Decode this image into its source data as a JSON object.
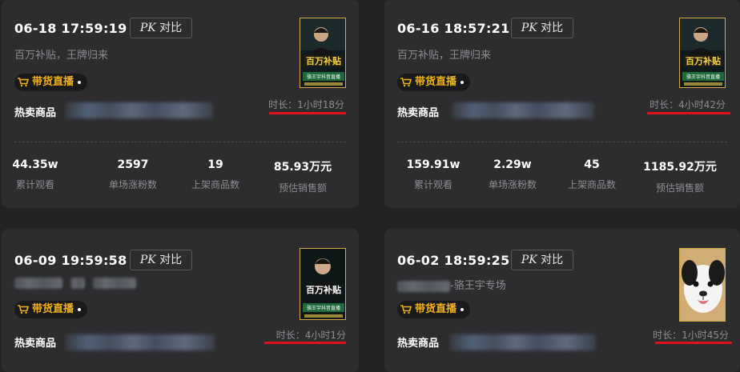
{
  "cards": [
    {
      "datetime": "06-18 17:59:19",
      "pk_label": "对比",
      "pk_italic": "PK",
      "subtitle": "百万补贴，王牌归来",
      "badge": "带货直播",
      "hot_label": "热卖商品",
      "duration": "时长：1小时18分",
      "stats": [
        {
          "value": "44.35w",
          "label": "累计观看"
        },
        {
          "value": "2597",
          "label": "单场涨粉数"
        },
        {
          "value": "19",
          "label": "上架商品数"
        },
        {
          "value": "85.93万元",
          "label": "预估销售额"
        }
      ]
    },
    {
      "datetime": "06-16 18:57:21",
      "pk_label": "对比",
      "pk_italic": "PK",
      "subtitle": "百万补贴，王牌归来",
      "badge": "带货直播",
      "hot_label": "热卖商品",
      "duration": "时长：4小时42分",
      "stats": [
        {
          "value": "159.91w",
          "label": "累计观看"
        },
        {
          "value": "2.29w",
          "label": "单场涨粉数"
        },
        {
          "value": "45",
          "label": "上架商品数"
        },
        {
          "value": "1185.92万元",
          "label": "预估销售额"
        }
      ]
    },
    {
      "datetime": "06-09 19:59:58",
      "pk_label": "对比",
      "pk_italic": "PK",
      "subtitle": "",
      "badge": "带货直播",
      "hot_label": "热卖商品",
      "duration": "时长：4小时1分"
    },
    {
      "datetime": "06-02 18:59:25",
      "pk_label": "对比",
      "pk_italic": "PK",
      "subtitle": "-骆王宇专场",
      "badge": "带货直播",
      "hot_label": "热卖商品",
      "duration": "时长：1小时45分"
    }
  ],
  "thumbnails": {
    "poster_text_1": "百万补贴",
    "poster_text_2": "骆王宇抖音直播",
    "colors": {
      "frame": "#d6a84a",
      "poster_green": "#1f6a3a",
      "poster_gold": "#f5d24a"
    }
  },
  "colors": {
    "accent_underline": "#e3121a",
    "badge_text": "#f2b21a"
  }
}
